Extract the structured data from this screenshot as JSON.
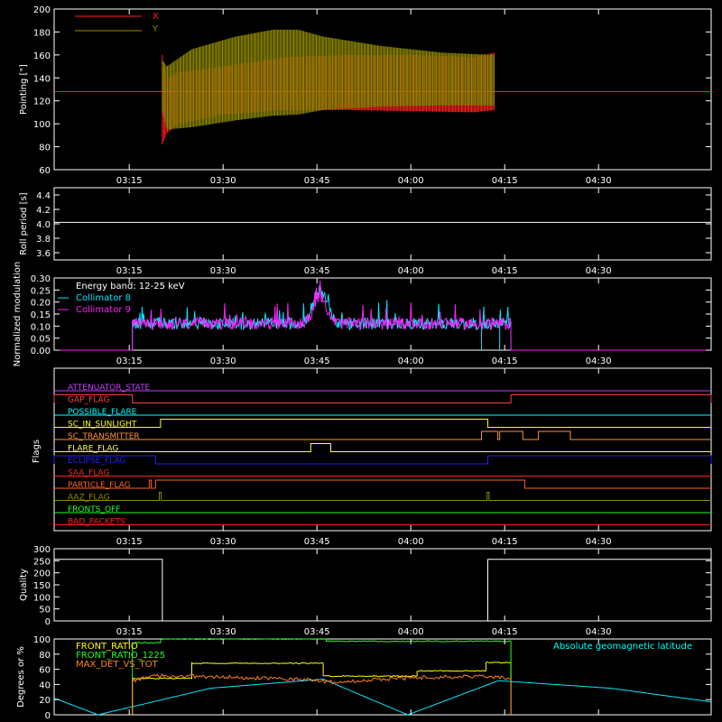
{
  "chart_data": {
    "type": "line",
    "time_ticks": [
      "03:15",
      "03:30",
      "03:45",
      "04:00",
      "04:15",
      "04:30"
    ],
    "time_tick_minutes": [
      195,
      210,
      225,
      240,
      255,
      270
    ],
    "time_range_minutes": [
      183,
      288
    ],
    "panels": [
      {
        "id": "pointing",
        "ylabel": "Pointing [\"]",
        "ylim": [
          60,
          200
        ],
        "yticks": [
          60,
          80,
          100,
          120,
          140,
          160,
          180,
          200
        ],
        "series": [
          {
            "name": "X",
            "color": "#ff2020",
            "baseline": 128,
            "active": [
              200.3,
              253.4
            ],
            "envelope": {
              "t": [
                200.3,
                201,
                203,
                210,
                220,
                230,
                240,
                250,
                253.4
              ],
              "low": [
                82,
                92,
                100,
                108,
                112,
                112,
                111,
                110,
                112
              ],
              "high": [
                160,
                140,
                145,
                150,
                158,
                160,
                160,
                158,
                162
              ]
            }
          },
          {
            "name": "Y",
            "color": "#8f8a00",
            "baseline": 128,
            "active": [
              200.3,
              253.4
            ],
            "envelope": {
              "t": [
                200.3,
                201,
                205,
                212,
                218,
                222,
                226,
                235,
                245,
                253.4
              ],
              "low": [
                110,
                95,
                97,
                103,
                107,
                108,
                112,
                115,
                116,
                116
              ],
              "high": [
                155,
                150,
                165,
                176,
                182,
                182,
                176,
                168,
                162,
                160
              ]
            }
          }
        ]
      },
      {
        "id": "roll_period",
        "ylabel": "Roll period [s]",
        "ylim": [
          3.5,
          4.5
        ],
        "yticks": [
          3.6,
          3.8,
          4.0,
          4.2,
          4.4
        ],
        "series": [
          {
            "name": "",
            "color": "#ffffff",
            "t": [
              183,
              288
            ],
            "values": [
              4.02,
              4.02
            ]
          }
        ]
      },
      {
        "id": "modulation",
        "ylabel": "Normalized modulation",
        "ylim": [
          0,
          0.3
        ],
        "yticks": [
          0.0,
          0.05,
          0.1,
          0.15,
          0.2,
          0.25,
          0.3
        ],
        "annotation": "Energy band: 12-25 keV",
        "active": [
          195.5,
          256
        ],
        "dips": [
          251.3,
          254.2
        ],
        "series": [
          {
            "name": "Collimator 8",
            "color": "#00e8ff",
            "level": 0.11,
            "peak_t": 225.5,
            "peak_v": 0.28
          },
          {
            "name": "Collimator 9",
            "color": "#ff20ff",
            "level": 0.11,
            "peak_t": 225.5,
            "peak_v": 0.24
          }
        ]
      },
      {
        "id": "flags",
        "ylabel": "Flags",
        "flags": [
          {
            "name": "ATTENUATOR_STATE",
            "color": "#c040ff",
            "high_intervals": []
          },
          {
            "name": "GAP_FLAG",
            "color": "#ff4040",
            "high_intervals": [
              [
                183,
                195.5
              ],
              [
                256,
                288
              ]
            ]
          },
          {
            "name": "POSSIBLE_FLARE",
            "color": "#00ffff",
            "high_intervals": []
          },
          {
            "name": "SC_IN_SUNLIGHT",
            "color": "#ffff00",
            "high_intervals": [
              [
                200,
                252.3
              ]
            ]
          },
          {
            "name": "SC_TRANSMITTER",
            "color": "#ff9030",
            "high_intervals": [
              [
                251.3,
                253.9
              ],
              [
                254.2,
                257.9
              ],
              [
                260.4,
                265.5
              ]
            ]
          },
          {
            "name": "FLARE_FLAG",
            "color": "#ffff40",
            "high_intervals": [
              [
                224,
                227.2
              ]
            ]
          },
          {
            "name": "ECLIPSE_FLAG",
            "color": "#2020ff",
            "high_intervals": [
              [
                183,
                199.2
              ],
              [
                252.3,
                288
              ]
            ]
          },
          {
            "name": "SAA_FLAG",
            "color": "#ff2020",
            "high_intervals": []
          },
          {
            "name": "PARTICLE_FLAG",
            "color": "#ff6020",
            "high_intervals": [
              [
                198.2,
                198.5
              ],
              [
                199.2,
                258.2
              ]
            ]
          },
          {
            "name": "AAZ_FLAG",
            "color": "#8f8a00",
            "high_intervals": [
              [
                199.8,
                200.1
              ],
              [
                252.2,
                252.5
              ]
            ]
          },
          {
            "name": "FRONTS_OFF",
            "color": "#20ff20",
            "high_intervals": []
          },
          {
            "name": "BAD_PACKETS",
            "color": "#ff2020",
            "high_intervals": []
          }
        ]
      },
      {
        "id": "quality",
        "ylabel": "Quality",
        "ylim": [
          0,
          300
        ],
        "yticks": [
          0,
          50,
          100,
          150,
          200,
          250,
          300
        ],
        "series": [
          {
            "name": "",
            "color": "#ffffff",
            "t": [
              183,
              200.3,
              200.3,
              252.3,
              252.3,
              288
            ],
            "values": [
              256,
              256,
              0,
              0,
              256,
              256
            ]
          }
        ]
      },
      {
        "id": "geomag",
        "ylabel": "Degrees or %",
        "ylim": [
          0,
          100
        ],
        "yticks": [
          0,
          20,
          40,
          60,
          80,
          100
        ],
        "annotation": "Absolute geomagnetic latitude",
        "annotation_color": "#00ffff",
        "latitude": {
          "color": "#00e8ff",
          "t": [
            183,
            190,
            208,
            226,
            239.5,
            254,
            272,
            288
          ],
          "values": [
            22,
            0,
            35,
            47,
            0,
            45,
            35,
            17
          ]
        },
        "series": [
          {
            "name": "FRONT_RATIO",
            "color": "#ffff00",
            "t": [
              195.5,
              195.5,
              205,
              205,
              226,
              226,
              241,
              241,
              252,
              252,
              256,
              256
            ],
            "values": [
              0,
              48,
              48,
              68,
              68,
              51,
              51,
              58,
              58,
              69,
              69,
              0
            ]
          },
          {
            "name": "FRONT_RATIO_1225",
            "color": "#20ff20",
            "t": [
              195.5,
              195.5,
              200,
              200,
              226.5,
              226.5,
              256,
              256
            ],
            "values": [
              0,
              95,
              95,
              100,
              100,
              97,
              97,
              0
            ]
          },
          {
            "name": "MAX_DET_VS_TOT",
            "color": "#ff8020",
            "t": [
              195.5,
              195.5,
              200,
              210,
              220,
              224,
              228,
              235,
              245,
              252,
              256,
              256
            ],
            "values": [
              0,
              45,
              52,
              50,
              47,
              46,
              43,
              47,
              50,
              51,
              48,
              0
            ]
          }
        ]
      }
    ]
  }
}
